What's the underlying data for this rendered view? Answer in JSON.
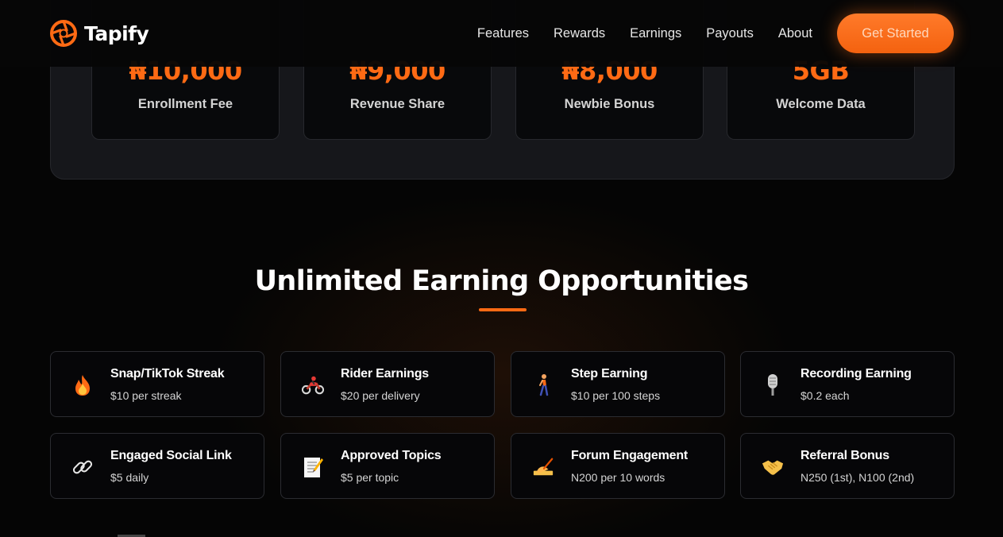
{
  "navbar": {
    "brand": "Tapify",
    "links": [
      "Features",
      "Rewards",
      "Earnings",
      "Payouts",
      "About"
    ],
    "cta": "Get Started"
  },
  "stats": [
    {
      "value": "₦10,000",
      "label": "Enrollment Fee"
    },
    {
      "value": "₦9,000",
      "label": "Revenue Share"
    },
    {
      "value": "₦8,000",
      "label": "Newbie Bonus"
    },
    {
      "value": "5GB",
      "label": "Welcome Data"
    }
  ],
  "section": {
    "title": "Unlimited Earning Opportunities"
  },
  "earnings": [
    {
      "icon": "fire-icon",
      "title": "Snap/TikTok Streak",
      "value": "$10 per streak"
    },
    {
      "icon": "motorcycle-icon",
      "title": "Rider Earnings",
      "value": "$20 per delivery"
    },
    {
      "icon": "walking-person-icon",
      "title": "Step Earning",
      "value": "$10 per 100 steps"
    },
    {
      "icon": "microphone-icon",
      "title": "Recording Earning",
      "value": "$0.2 each"
    },
    {
      "icon": "link-icon",
      "title": "Engaged Social Link",
      "value": "$5 daily"
    },
    {
      "icon": "memo-icon",
      "title": "Approved Topics",
      "value": "$5 per topic"
    },
    {
      "icon": "writing-hand-icon",
      "title": "Forum Engagement",
      "value": "N200 per 10 words"
    },
    {
      "icon": "handshake-icon",
      "title": "Referral Bonus",
      "value": "N250 (1st), N100 (2nd)"
    }
  ],
  "colors": {
    "accent": "#ff6a14",
    "background": "#050505",
    "panel": "#16171b",
    "card": "#08090b"
  }
}
